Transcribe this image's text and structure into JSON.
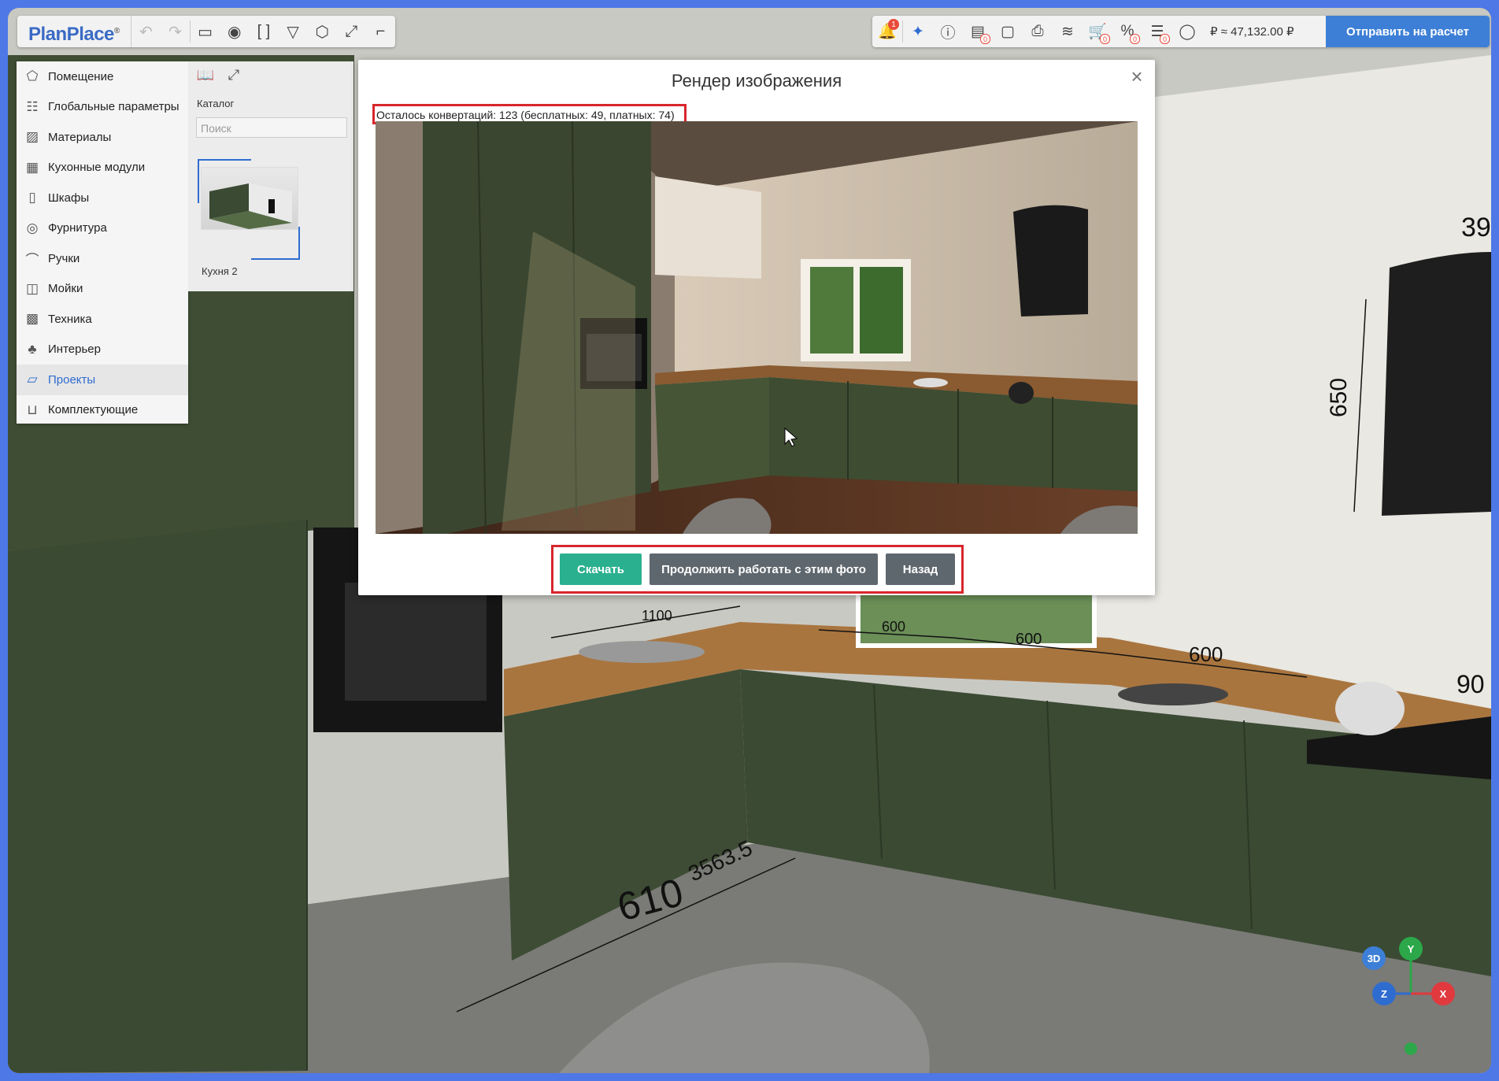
{
  "app": {
    "logo": "PlanPlace",
    "logo_mark": "®"
  },
  "toolbar": {
    "left_icons": [
      "undo-icon",
      "redo-icon",
      "file-icon",
      "eye-icon",
      "bracket-icon",
      "filter-icon",
      "cube-icon",
      "expand-icon",
      "corner-icon"
    ],
    "right_icons": [
      "notification-icon",
      "ai-sparkle-icon",
      "info-icon",
      "report-icon",
      "chat-icon",
      "print-icon",
      "layers-icon",
      "cart-icon",
      "percent-icon",
      "list-icon",
      "user-icon"
    ],
    "notification_count": "1",
    "cart_count": "0",
    "percent_count": "0",
    "list_count": "0",
    "report_count": "0",
    "currency_symbol": "₽",
    "price": "≈   47,132.00 ₽",
    "send_label": "Отправить на расчет"
  },
  "sidebar": {
    "items": [
      {
        "label": "Помещение",
        "icon": "room-icon"
      },
      {
        "label": "Глобальные параметры",
        "icon": "sliders-icon"
      },
      {
        "label": "Материалы",
        "icon": "materials-icon"
      },
      {
        "label": "Кухонные модули",
        "icon": "kitchen-modules-icon"
      },
      {
        "label": "Шкафы",
        "icon": "wardrobe-icon"
      },
      {
        "label": "Фурнитура",
        "icon": "hardware-icon"
      },
      {
        "label": "Ручки",
        "icon": "handle-icon"
      },
      {
        "label": "Мойки",
        "icon": "sink-icon"
      },
      {
        "label": "Техника",
        "icon": "appliance-icon"
      },
      {
        "label": "Интерьер",
        "icon": "interior-icon"
      },
      {
        "label": "Проекты",
        "icon": "folder-icon",
        "active": true
      },
      {
        "label": "Комплектующие",
        "icon": "cart-icon"
      }
    ]
  },
  "catalog": {
    "title": "Каталог",
    "search_placeholder": "Поиск",
    "project_label": "Кухня 2"
  },
  "modal": {
    "title": "Рендер изображения",
    "conversions": "Осталось конвертаций: 123 (бесплатных: 49, платных: 74)",
    "download_label": "Скачать",
    "continue_label": "Продолжить работать с этим фото",
    "back_label": "Назад"
  },
  "scene": {
    "dimensions": [
      "1100",
      "600",
      "600",
      "600",
      "90",
      "39",
      "650",
      "610",
      "3563.5"
    ]
  },
  "gizmo": {
    "mode": "3D",
    "axis_x": "X",
    "axis_y": "Y",
    "axis_z": "Z"
  },
  "colors": {
    "accent_blue": "#3d7fd6",
    "download_green": "#2bb08f",
    "highlight_red": "#d8262c",
    "cabinet_green": "#3b4a33"
  }
}
